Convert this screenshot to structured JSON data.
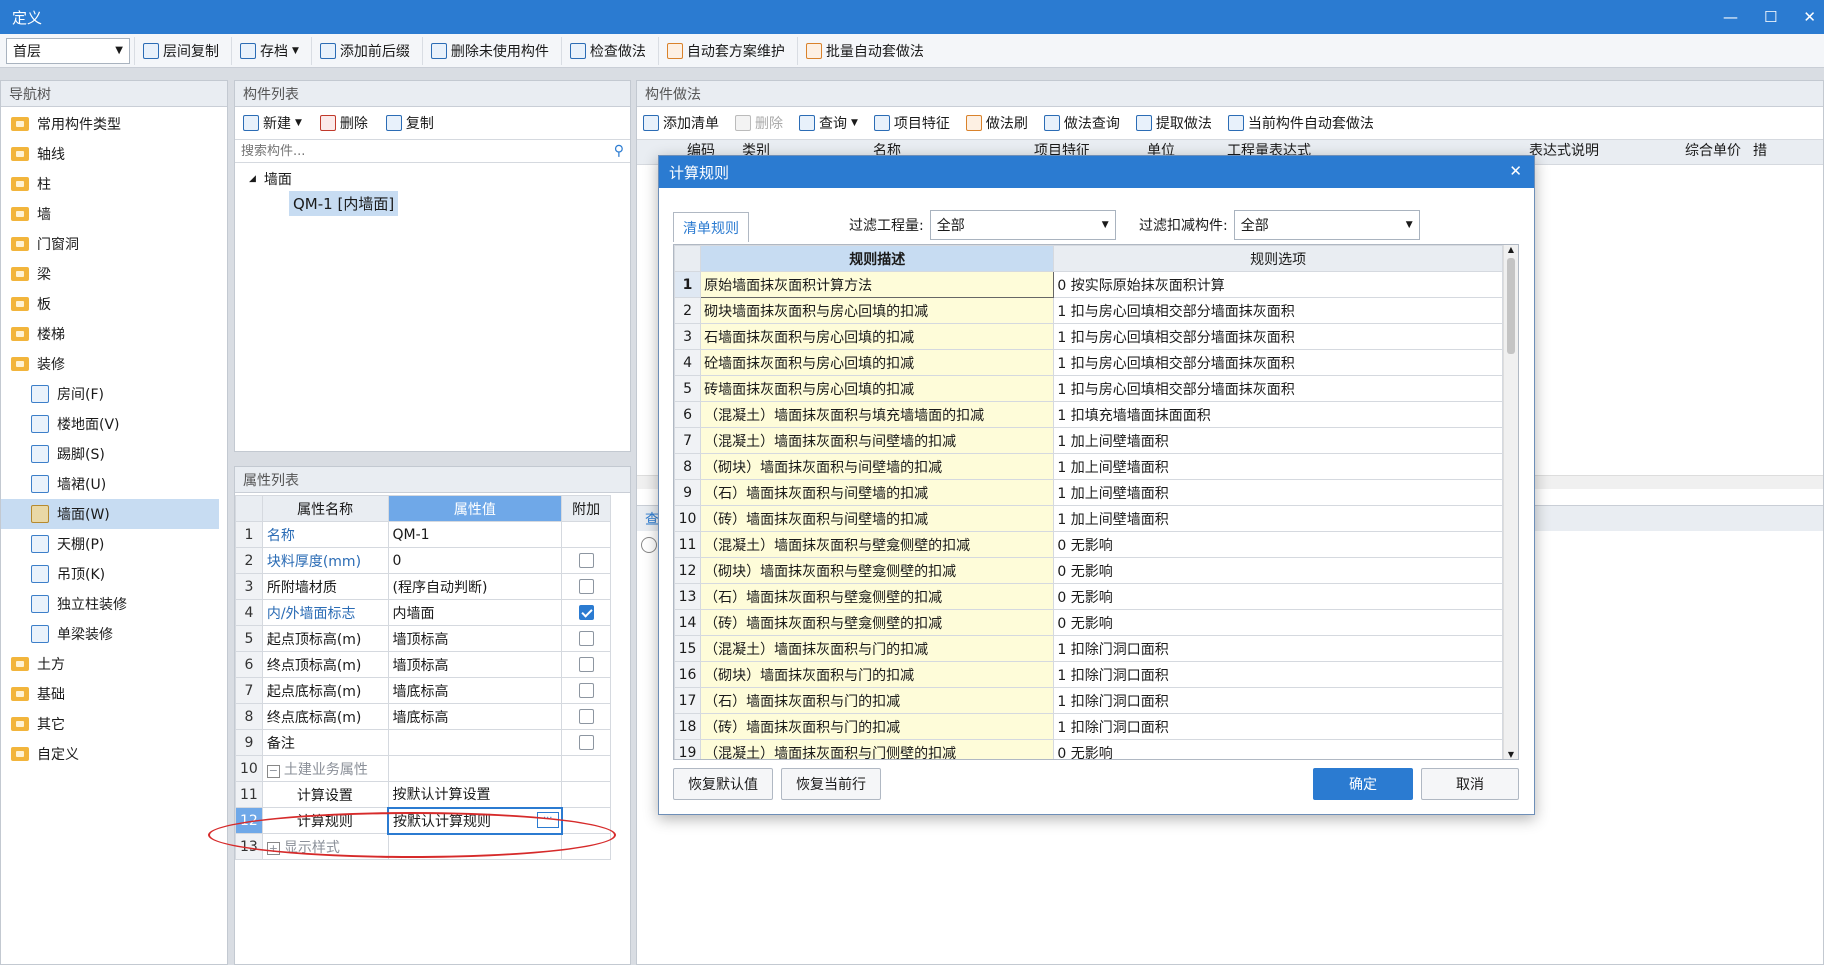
{
  "window": {
    "title": "定义",
    "min": "—",
    "max": "☐",
    "close": "✕"
  },
  "toolbar": {
    "floor_select": "首层",
    "buttons": [
      "层间复制",
      "存档",
      "添加前后缀",
      "删除未使用构件",
      "检查做法",
      "自动套方案维护",
      "批量自动套做法"
    ]
  },
  "nav": {
    "header": "导航树",
    "items": [
      {
        "label": "常用构件类型"
      },
      {
        "label": "轴线"
      },
      {
        "label": "柱"
      },
      {
        "label": "墙"
      },
      {
        "label": "门窗洞"
      },
      {
        "label": "梁"
      },
      {
        "label": "板"
      },
      {
        "label": "楼梯"
      },
      {
        "label": "装修"
      }
    ],
    "sub_items": [
      {
        "label": "房间(F)"
      },
      {
        "label": "楼地面(V)"
      },
      {
        "label": "踢脚(S)"
      },
      {
        "label": "墙裙(U)"
      },
      {
        "label": "墙面(W)"
      },
      {
        "label": "天棚(P)"
      },
      {
        "label": "吊顶(K)"
      },
      {
        "label": "独立柱装修"
      },
      {
        "label": "单梁装修"
      }
    ],
    "tail_items": [
      {
        "label": "土方"
      },
      {
        "label": "基础"
      },
      {
        "label": "其它"
      },
      {
        "label": "自定义"
      }
    ]
  },
  "component_list": {
    "header": "构件列表",
    "new": "新建",
    "delete": "删除",
    "copy": "复制",
    "search_placeholder": "搜索构件...",
    "group": "墙面",
    "item": "QM-1 [内墙面]"
  },
  "props": {
    "header": "属性列表",
    "col_name": "属性名称",
    "col_value": "属性值",
    "col_extra": "附加",
    "rows": [
      {
        "n": "1",
        "name": "名称",
        "value": "QM-1"
      },
      {
        "n": "2",
        "name": "块料厚度(mm)",
        "value": "0"
      },
      {
        "n": "3",
        "name": "所附墙材质",
        "value": "(程序自动判断)"
      },
      {
        "n": "4",
        "name": "内/外墙面标志",
        "value": "内墙面"
      },
      {
        "n": "5",
        "name": "起点顶标高(m)",
        "value": "墙顶标高"
      },
      {
        "n": "6",
        "name": "终点顶标高(m)",
        "value": "墙顶标高"
      },
      {
        "n": "7",
        "name": "起点底标高(m)",
        "value": "墙底标高"
      },
      {
        "n": "8",
        "name": "终点底标高(m)",
        "value": "墙底标高"
      },
      {
        "n": "9",
        "name": "备注",
        "value": ""
      },
      {
        "n": "10",
        "name": "土建业务属性",
        "value": ""
      },
      {
        "n": "11",
        "name": "计算设置",
        "value": "按默认计算设置"
      },
      {
        "n": "12",
        "name": "计算规则",
        "value": "按默认计算规则"
      },
      {
        "n": "13",
        "name": "显示样式",
        "value": ""
      }
    ]
  },
  "method": {
    "header": "构件做法",
    "buttons": [
      "添加清单",
      "删除",
      "查询",
      "项目特征",
      "做法刷",
      "做法查询",
      "提取做法",
      "当前构件自动套做法"
    ],
    "columns": [
      "编码",
      "类别",
      "名称",
      "项目特征",
      "单位",
      "工程量表达式",
      "表达式说明",
      "综合单价",
      "措"
    ],
    "query_tab": "查"
  },
  "dialog": {
    "title": "计算规则",
    "tab": "清单规则",
    "filter_qty_label": "过滤工程量:",
    "filter_qty_value": "全部",
    "filter_deduct_label": "过滤扣减构件:",
    "filter_deduct_value": "全部",
    "col_desc": "规则描述",
    "col_opt": "规则选项",
    "rows": [
      {
        "n": "1",
        "desc": "原始墙面抹灰面积计算方法",
        "opt": "0 按实际原始抹灰面积计算"
      },
      {
        "n": "2",
        "desc": "砌块墙面抹灰面积与房心回填的扣减",
        "opt": "1 扣与房心回填相交部分墙面抹灰面积"
      },
      {
        "n": "3",
        "desc": "石墙面抹灰面积与房心回填的扣减",
        "opt": "1 扣与房心回填相交部分墙面抹灰面积"
      },
      {
        "n": "4",
        "desc": "砼墙面抹灰面积与房心回填的扣减",
        "opt": "1 扣与房心回填相交部分墙面抹灰面积"
      },
      {
        "n": "5",
        "desc": "砖墙面抹灰面积与房心回填的扣减",
        "opt": "1 扣与房心回填相交部分墙面抹灰面积"
      },
      {
        "n": "6",
        "desc": "（混凝土）墙面抹灰面积与填充墙墙面的扣减",
        "opt": "1 扣填充墙墙面抹面面积"
      },
      {
        "n": "7",
        "desc": "（混凝土）墙面抹灰面积与间壁墙的扣减",
        "opt": "1 加上间壁墙面积"
      },
      {
        "n": "8",
        "desc": "（砌块）墙面抹灰面积与间壁墙的扣减",
        "opt": "1 加上间壁墙面积"
      },
      {
        "n": "9",
        "desc": "（石）墙面抹灰面积与间壁墙的扣减",
        "opt": "1 加上间壁墙面积"
      },
      {
        "n": "10",
        "desc": "（砖）墙面抹灰面积与间壁墙的扣减",
        "opt": "1 加上间壁墙面积"
      },
      {
        "n": "11",
        "desc": "（混凝土）墙面抹灰面积与壁龛侧壁的扣减",
        "opt": "0  无影响"
      },
      {
        "n": "12",
        "desc": "（砌块）墙面抹灰面积与壁龛侧壁的扣减",
        "opt": "0  无影响"
      },
      {
        "n": "13",
        "desc": "（石）墙面抹灰面积与壁龛侧壁的扣减",
        "opt": "0  无影响"
      },
      {
        "n": "14",
        "desc": "（砖）墙面抹灰面积与壁龛侧壁的扣减",
        "opt": "0  无影响"
      },
      {
        "n": "15",
        "desc": "（混凝土）墙面抹灰面积与门的扣减",
        "opt": "1 扣除门洞口面积"
      },
      {
        "n": "16",
        "desc": "（砌块）墙面抹灰面积与门的扣减",
        "opt": "1 扣除门洞口面积"
      },
      {
        "n": "17",
        "desc": "（石）墙面抹灰面积与门的扣减",
        "opt": "1 扣除门洞口面积"
      },
      {
        "n": "18",
        "desc": "（砖）墙面抹灰面积与门的扣减",
        "opt": "1 扣除门洞口面积"
      },
      {
        "n": "19",
        "desc": "（混凝土）墙面抹灰面积与门侧壁的扣减",
        "opt": "0  无影响"
      }
    ],
    "restore_default": "恢复默认值",
    "restore_row": "恢复当前行",
    "ok": "确定",
    "cancel": "取消"
  },
  "colors": {
    "accent": "#2b7bd1",
    "highlight_ellipse": "#d62a2a",
    "desc_bg": "#fefcd9"
  }
}
